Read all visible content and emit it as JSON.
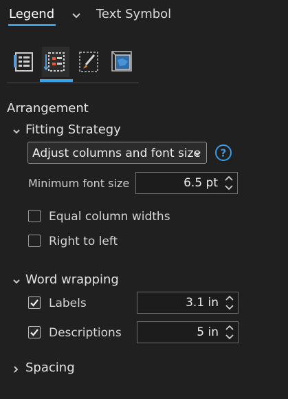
{
  "tabs": {
    "legend": "Legend",
    "text_symbol": "Text Symbol",
    "active": "legend",
    "accent_color": "#3aa0e8"
  },
  "icon_toolbar": [
    {
      "name": "legend-options-icon",
      "active": false
    },
    {
      "name": "arrangement-icon",
      "active": true
    },
    {
      "name": "symbol-brush-icon",
      "active": false
    },
    {
      "name": "display-frame-icon",
      "active": false
    }
  ],
  "arrangement": {
    "heading": "Arrangement",
    "fitting_strategy": {
      "heading": "Fitting Strategy",
      "expanded": true,
      "dropdown_value": "Adjust columns and font size",
      "help_icon": "question-circle-icon",
      "min_font_label": "Minimum font size",
      "min_font_value": "6.5 pt",
      "equal_column_widths": {
        "label": "Equal column widths",
        "checked": false
      },
      "right_to_left": {
        "label": "Right to left",
        "checked": false
      }
    },
    "word_wrapping": {
      "heading": "Word wrapping",
      "expanded": true,
      "labels": {
        "label": "Labels",
        "checked": true,
        "value": "3.1 in"
      },
      "descriptions": {
        "label": "Descriptions",
        "checked": true,
        "value": "5 in"
      }
    },
    "spacing": {
      "heading": "Spacing",
      "expanded": false
    }
  }
}
